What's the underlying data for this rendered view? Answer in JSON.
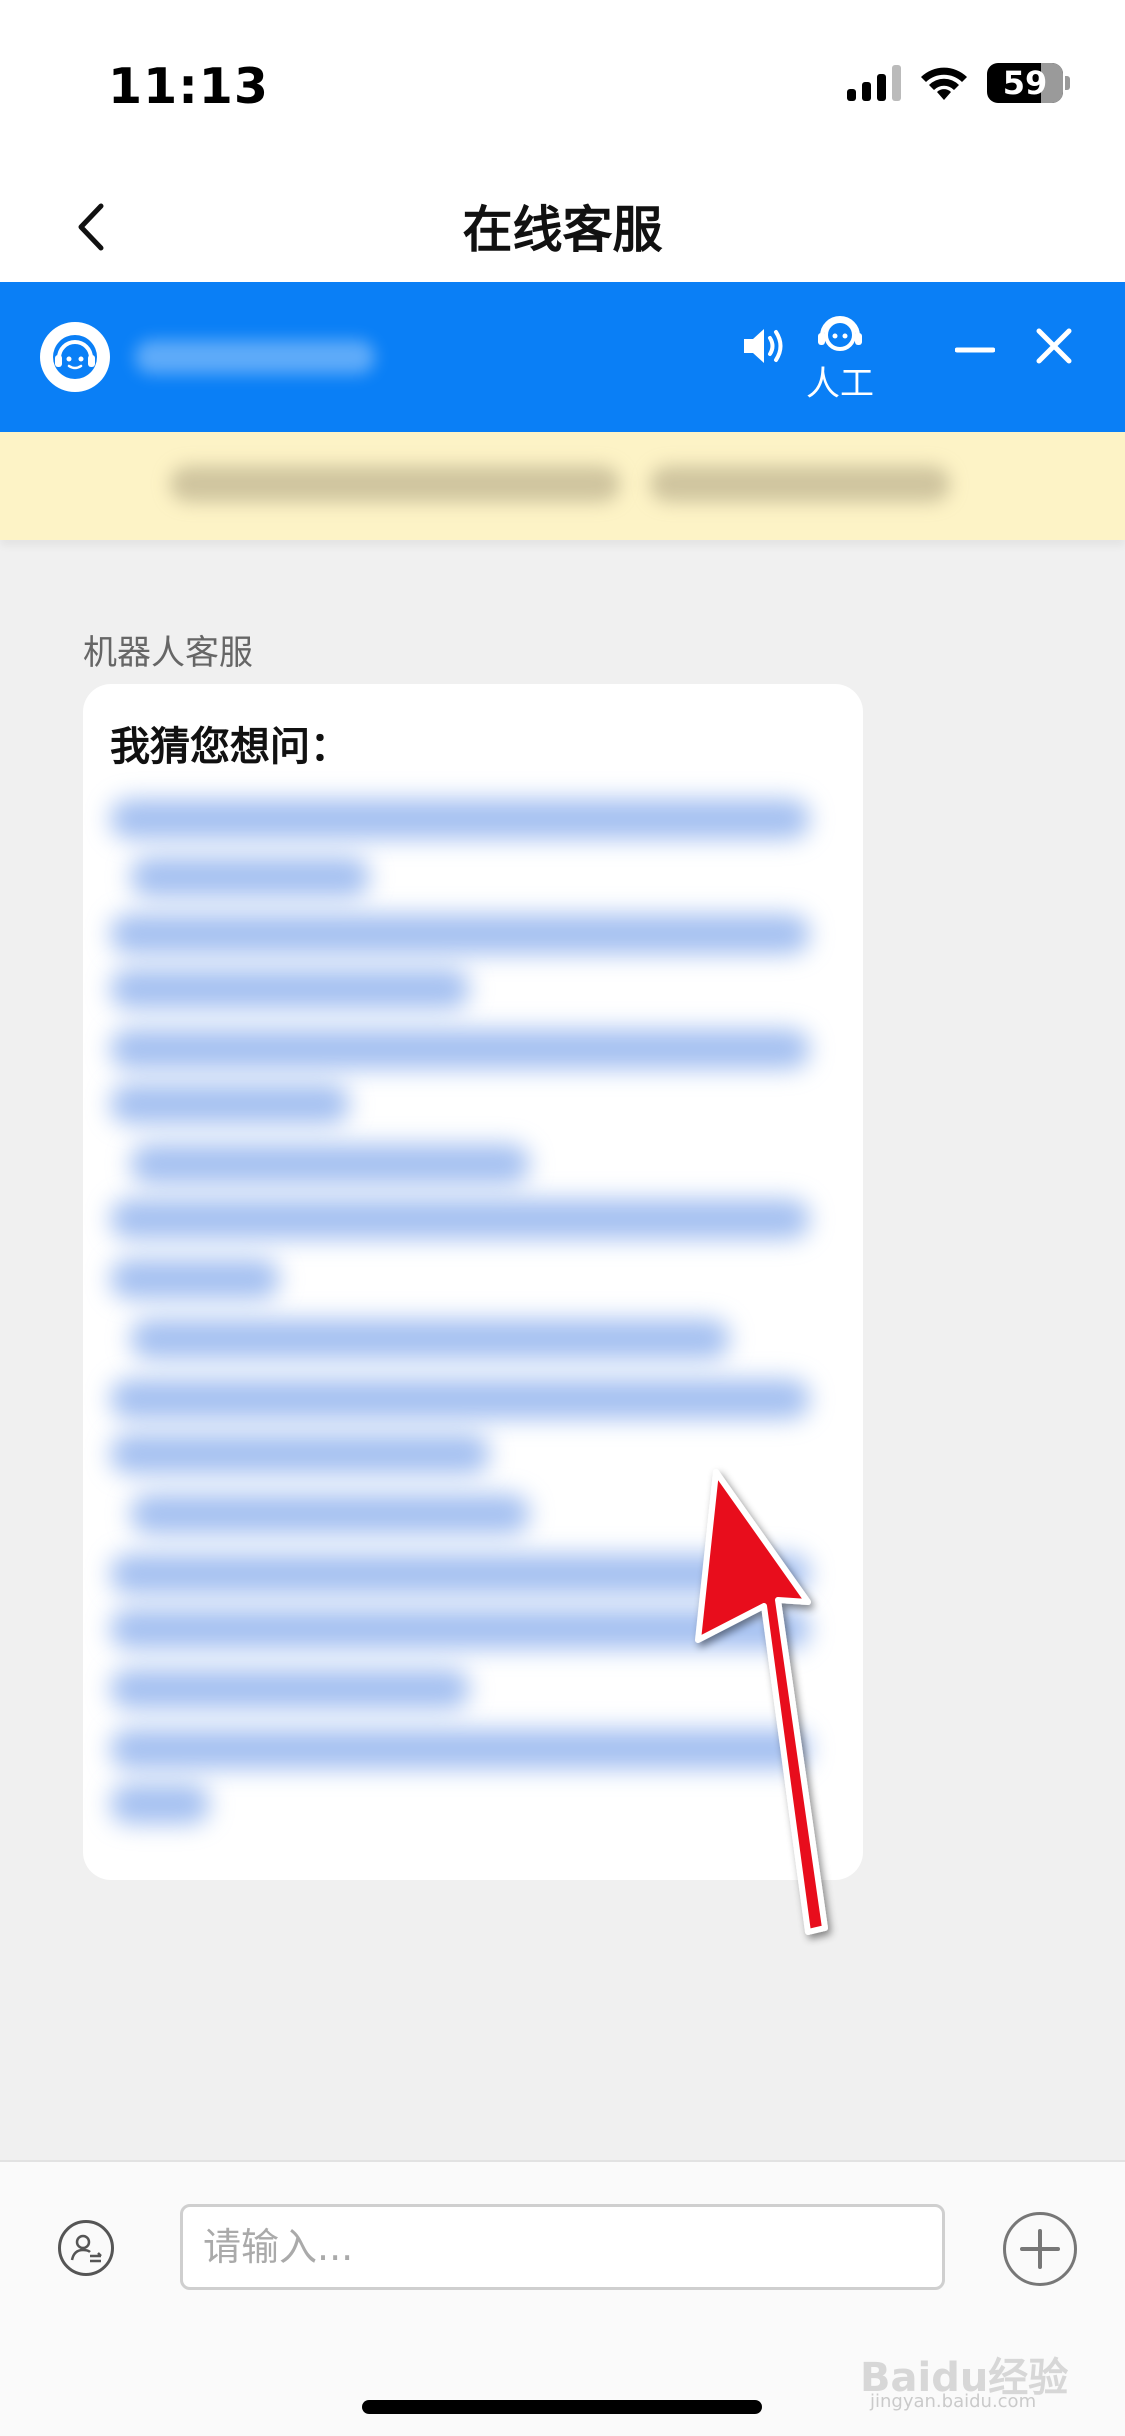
{
  "status_bar": {
    "time": "11:13",
    "battery": "59"
  },
  "nav": {
    "title": "在线客服"
  },
  "cs_header": {
    "human_label": "人工"
  },
  "chat": {
    "bot_label": "机器人客服",
    "bubble_title": "我猜您想问："
  },
  "input": {
    "placeholder": "请输入..."
  },
  "watermark": {
    "brand": "Baidu经验",
    "url": "jingyan.baidu.com"
  },
  "colors": {
    "accent": "#0a7ff6",
    "notice_bg": "#fdf3c6",
    "arrow": "#e8101a"
  }
}
